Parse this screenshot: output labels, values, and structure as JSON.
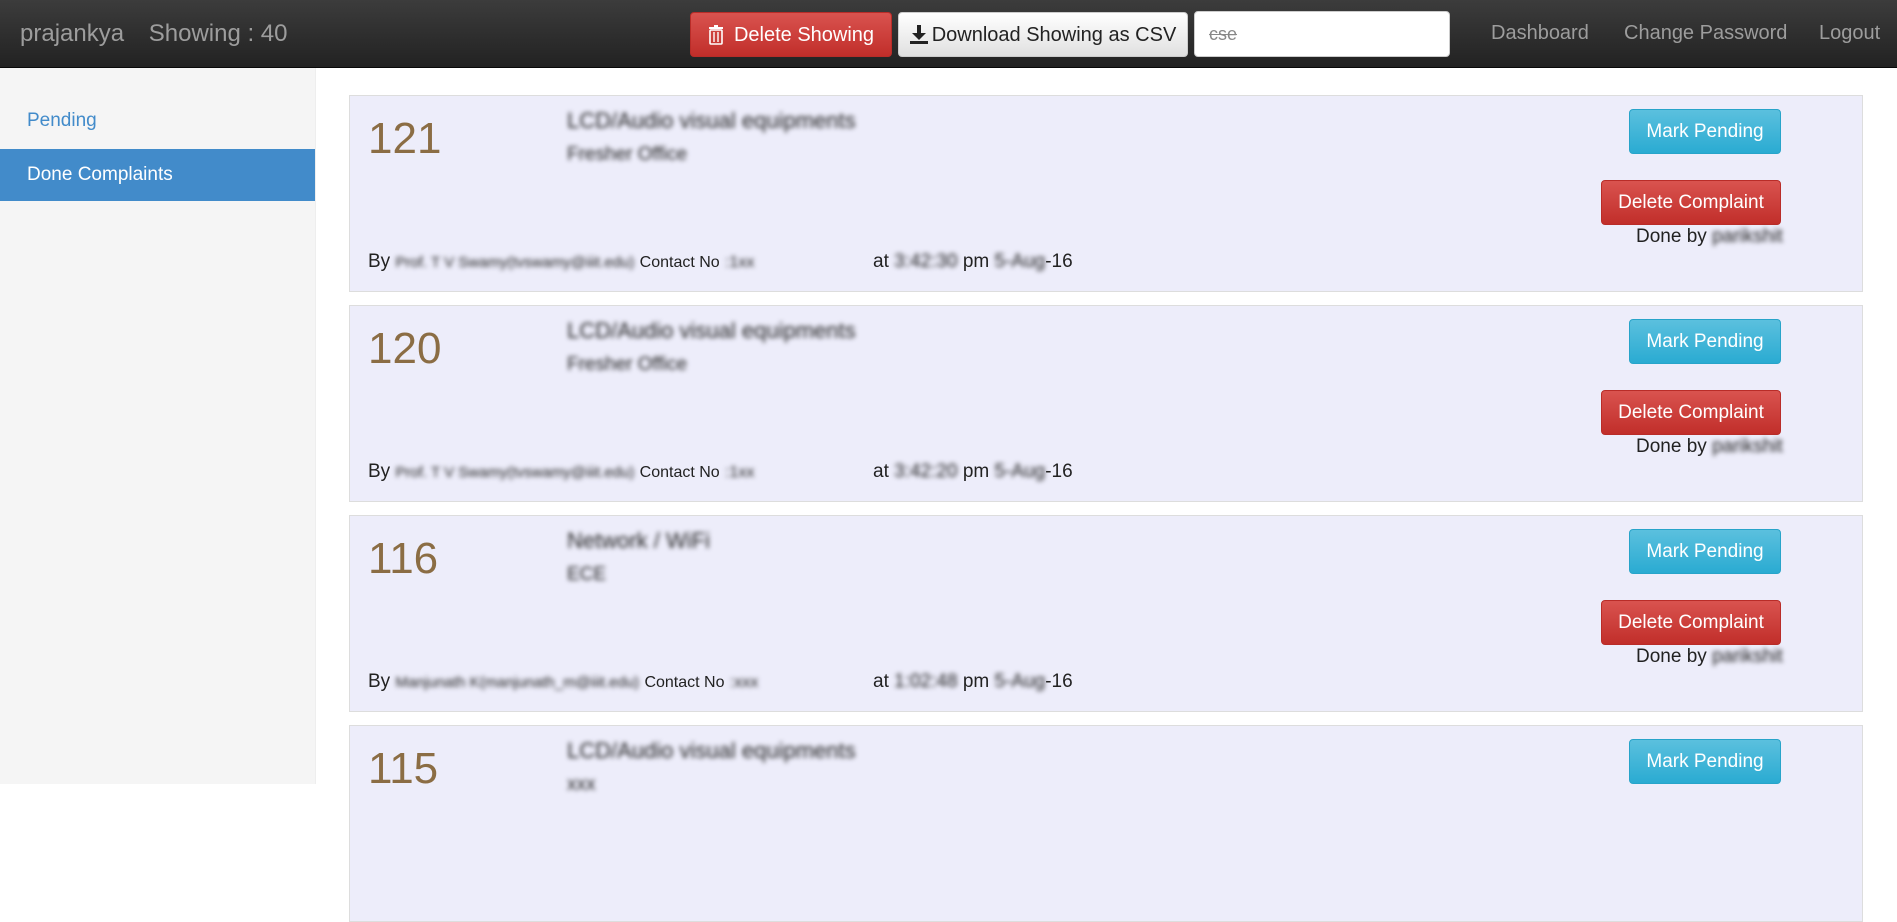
{
  "navbar": {
    "brand": "prajankya",
    "showing_label": "Showing : 40",
    "delete_showing": "Delete Showing",
    "download_csv": "Download Showing as CSV",
    "search_value": "cse",
    "links": [
      "Dashboard",
      "Change Password",
      "Logout"
    ]
  },
  "sidebar": {
    "items": [
      {
        "label": "Pending"
      },
      {
        "label": "Done Complaints"
      }
    ]
  },
  "cards": [
    {
      "id": "121",
      "category": "LCD/Audio visual equipments",
      "location": "Fresher Office",
      "by_prefix": "By",
      "by_name": "Prof. T V Swamy(tvswamy@iiit.edu)",
      "contact_label": "Contact No",
      "contact_value": ":1xx",
      "at_prefix": "at",
      "time": "3:42:30",
      "pm": "pm",
      "date_blur": "5-Aug",
      "date_year": "-16",
      "mark_pending": "Mark Pending",
      "delete_complaint": "Delete Complaint",
      "done_by_label": "Done by",
      "done_by_user": "parikshit"
    },
    {
      "id": "120",
      "category": "LCD/Audio visual equipments",
      "location": "Fresher Office",
      "by_prefix": "By",
      "by_name": "Prof. T V Swamy(tvswamy@iiit.edu)",
      "contact_label": "Contact No",
      "contact_value": ":1xx",
      "at_prefix": "at",
      "time": "3:42:20",
      "pm": "pm",
      "date_blur": "5-Aug",
      "date_year": "-16",
      "mark_pending": "Mark Pending",
      "delete_complaint": "Delete Complaint",
      "done_by_label": "Done by",
      "done_by_user": "parikshit"
    },
    {
      "id": "116",
      "category": "Network / WiFi",
      "location": "ECE",
      "by_prefix": "By",
      "by_name": "Manjunath K(manjunath_m@iiit.edu)",
      "contact_label": "Contact No",
      "contact_value": ":xxx",
      "at_prefix": "at",
      "time": "1:02:48",
      "pm": "pm",
      "date_blur": "5-Aug",
      "date_year": "-16",
      "mark_pending": "Mark Pending",
      "delete_complaint": "Delete Complaint",
      "done_by_label": "Done by",
      "done_by_user": "parikshit"
    },
    {
      "id": "115",
      "category": "LCD/Audio visual equipments",
      "location": "xxx",
      "mark_pending": "Mark Pending"
    }
  ],
  "colors": {
    "navbar": "#222222",
    "accent": "#428bca",
    "danger": "#d9534f",
    "info": "#5bc0de",
    "card_bg": "#ededfa",
    "id_color": "#8b6d44"
  },
  "icons": {
    "delete_showing": "trash-icon",
    "download_csv": "download-icon"
  }
}
